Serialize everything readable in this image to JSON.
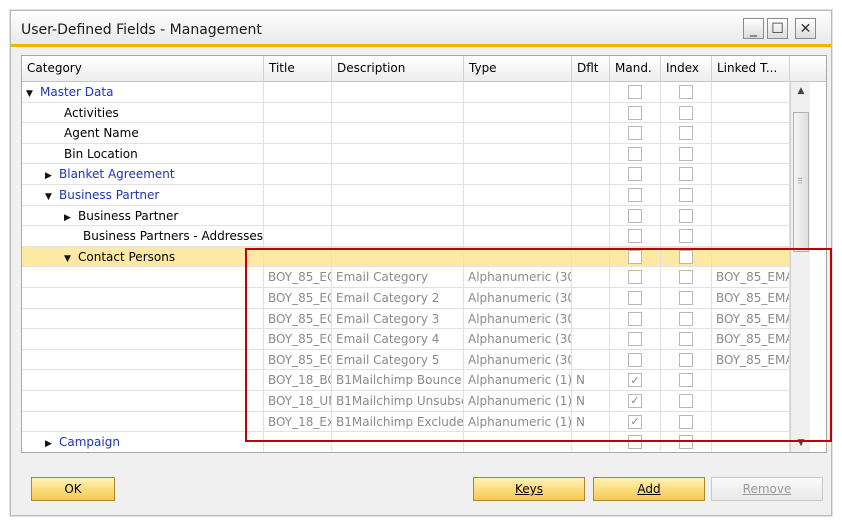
{
  "window": {
    "title": "User-Defined Fields - Management",
    "min_label": "_",
    "max_label": "☐",
    "close_label": "✕"
  },
  "columns": [
    "Category",
    "Title",
    "Description",
    "Type",
    "Dflt",
    "Mand.",
    "Index",
    "Linked T..."
  ],
  "tree": [
    {
      "label": "Master Data",
      "indent": 0,
      "expander": "▼",
      "link": true
    },
    {
      "label": "Activities",
      "indent": 2,
      "expander": "",
      "link": false
    },
    {
      "label": "Agent Name",
      "indent": 2,
      "expander": "",
      "link": false
    },
    {
      "label": "Bin Location",
      "indent": 2,
      "expander": "",
      "link": false
    },
    {
      "label": "Blanket Agreement",
      "indent": 1,
      "expander": "▶",
      "link": true
    },
    {
      "label": "Business Partner",
      "indent": 1,
      "expander": "▼",
      "link": true
    },
    {
      "label": "Business Partner",
      "indent": 2,
      "expander": "▶",
      "link": false
    },
    {
      "label": "Business Partners - Addresses",
      "indent": 3,
      "expander": "",
      "link": false
    },
    {
      "label": "Contact Persons",
      "indent": 2,
      "expander": "▼",
      "link": false,
      "selected": true
    }
  ],
  "fields": [
    {
      "title": "BOY_85_EC",
      "description": "Email Category",
      "type": "Alphanumeric (30",
      "dflt": "",
      "mand": false,
      "linked": "BOY_85_EMA"
    },
    {
      "title": "BOY_85_EC",
      "description": "Email Category 2",
      "type": "Alphanumeric (30",
      "dflt": "",
      "mand": false,
      "linked": "BOY_85_EMA"
    },
    {
      "title": "BOY_85_EC",
      "description": "Email Category 3",
      "type": "Alphanumeric (30",
      "dflt": "",
      "mand": false,
      "linked": "BOY_85_EMA"
    },
    {
      "title": "BOY_85_EC",
      "description": "Email Category 4",
      "type": "Alphanumeric (30",
      "dflt": "",
      "mand": false,
      "linked": "BOY_85_EMA"
    },
    {
      "title": "BOY_85_EC",
      "description": "Email Category 5",
      "type": "Alphanumeric (30",
      "dflt": "",
      "mand": false,
      "linked": "BOY_85_EMA"
    },
    {
      "title": "BOY_18_BC",
      "description": "B1Mailchimp Bounce",
      "type": "Alphanumeric (1)",
      "dflt": "N",
      "mand": true,
      "linked": ""
    },
    {
      "title": "BOY_18_UN",
      "description": "B1Mailchimp Unsubscri",
      "type": "Alphanumeric (1)",
      "dflt": "N",
      "mand": true,
      "linked": ""
    },
    {
      "title": "BOY_18_Ex",
      "description": "B1Mailchimp Exclude",
      "type": "Alphanumeric (1)",
      "dflt": "N",
      "mand": true,
      "linked": ""
    }
  ],
  "trailing_row": {
    "label": "Campaign",
    "expander": "▶"
  },
  "scrollbar": {
    "up": "▲",
    "down": "▼",
    "grip": "⠿"
  },
  "buttons": {
    "ok": "OK",
    "keys": "Keys",
    "add": "Add",
    "remove": "Remove"
  },
  "check_mark": "✓"
}
